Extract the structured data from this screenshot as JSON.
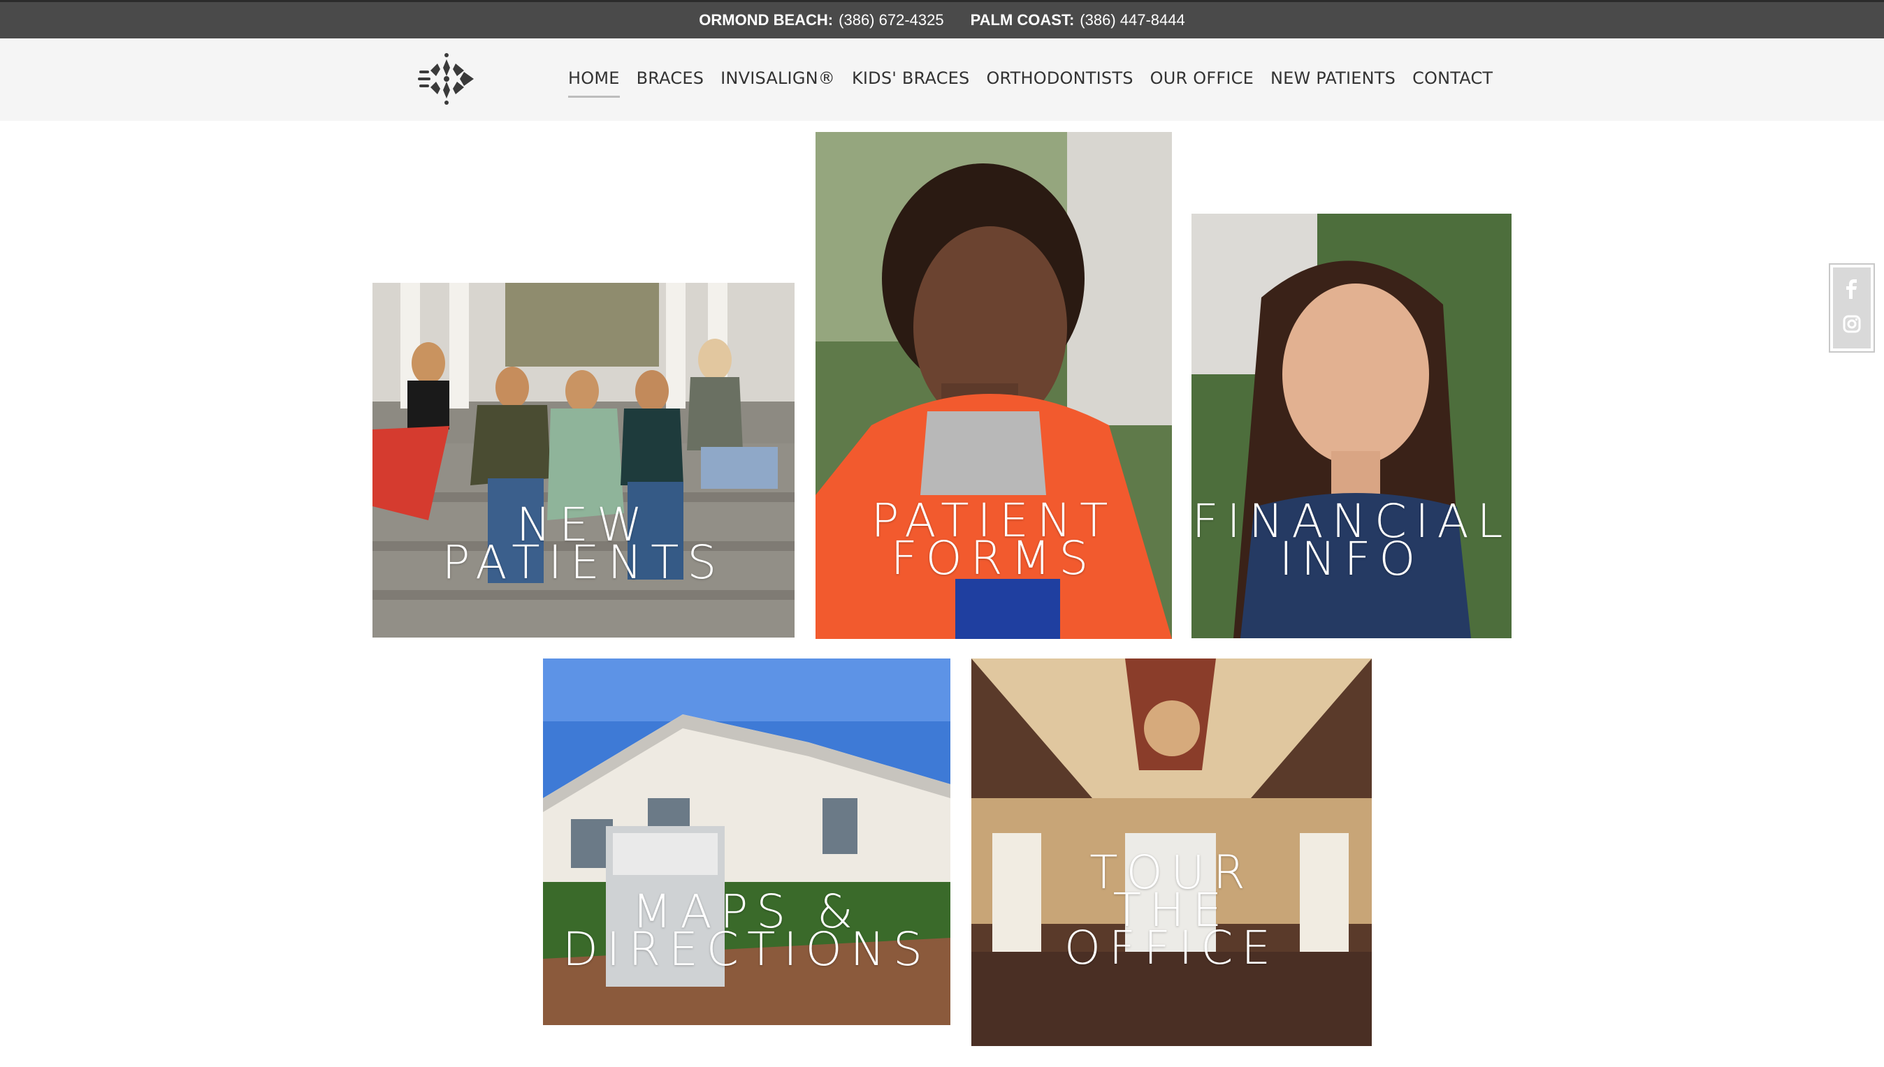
{
  "topbar": {
    "locations": [
      {
        "name": "ORMOND BEACH:",
        "phone": "(386) 672-4325"
      },
      {
        "name": "PALM COAST:",
        "phone": "(386) 447-8444"
      }
    ]
  },
  "nav": {
    "logo_icon": "leaf-tooth-logo-icon",
    "items": [
      {
        "label": "HOME",
        "active": true
      },
      {
        "label": "BRACES"
      },
      {
        "label": "INVISALIGN®"
      },
      {
        "label": "KIDS' BRACES"
      },
      {
        "label": "ORTHODONTISTS"
      },
      {
        "label": "OUR OFFICE"
      },
      {
        "label": "NEW PATIENTS"
      },
      {
        "label": "CONTACT"
      }
    ]
  },
  "tiles": [
    {
      "line1": "NEW",
      "line2": "PATIENTS"
    },
    {
      "line1": "PATIENT",
      "line2": "FORMS"
    },
    {
      "line1": "FINANCIAL",
      "line2": "INFO"
    },
    {
      "line1": "MAPS &",
      "line2": "DIRECTIONS"
    },
    {
      "line1": "TOUR",
      "line2": "THE",
      "line3": "OFFICE"
    }
  ],
  "social": {
    "icons": [
      "facebook-icon",
      "instagram-icon"
    ]
  },
  "colors": {
    "topbar_bg": "#4a4a4a",
    "nav_bg": "#f5f5f5",
    "nav_text": "#333333"
  }
}
